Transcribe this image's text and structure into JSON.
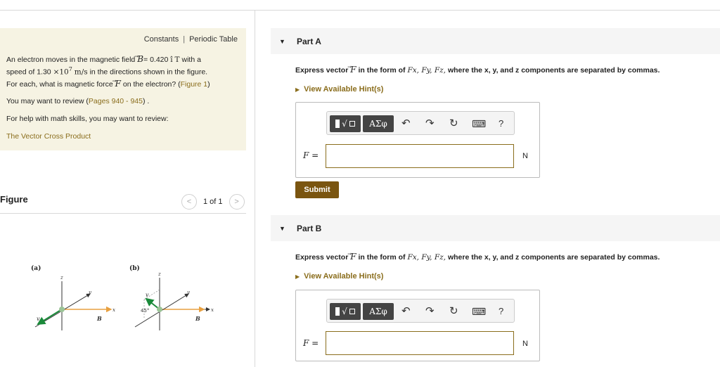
{
  "problem": {
    "links": {
      "constants": "Constants",
      "separator": "|",
      "periodic_table": "Periodic Table"
    },
    "line1_pre": "An electron moves in the magnetic field",
    "line1_B": "B",
    "line1_eq": "= 0.420",
    "line1_unit_vec": "î",
    "line1_unit": "T",
    "line1_post": "with a",
    "line2_pre": "speed of 1.30",
    "line2_times": "×10",
    "line2_exp": "7",
    "line2_unit": "m/s",
    "line2_post": "in the directions shown in the figure.",
    "line3_pre": "For each, what is magnetic force",
    "line3_F": "F",
    "line3_mid": "on the electron? (",
    "line3_link": "Figure 1",
    "line3_post": ")",
    "line4_pre": "You may want to review (",
    "line4_link": "Pages 940 - 945",
    "line4_post": ") .",
    "line5": "For help with math skills, you may want to review:",
    "line6_link": "The Vector Cross Product"
  },
  "figure": {
    "title": "Figure",
    "pager": "1 of 1",
    "prev": "<",
    "next": ">",
    "label_a": "(a)",
    "label_b": "(b)",
    "axis_x": "x",
    "axis_y": "y",
    "axis_z": "z",
    "vec_v": "v",
    "vec_B": "B",
    "angle": "45°"
  },
  "parts": [
    {
      "title": "Part A",
      "express_pre": "Express vector",
      "express_F": "F",
      "express_mid": "in the form of",
      "express_comps": "Fx, Fy, Fz,",
      "express_post": "where the x, y, and z components are separated by commas.",
      "hint": "View Available Hint(s)",
      "toolbar": {
        "greek": "ΑΣφ",
        "undo": "↶",
        "redo": "↷",
        "reset": "↻",
        "keyboard": "⌨",
        "help": "?"
      },
      "eq_label": "F =",
      "input_value": "",
      "unit": "N",
      "submit": "Submit"
    },
    {
      "title": "Part B",
      "express_pre": "Express vector",
      "express_F": "F",
      "express_mid": "in the form of",
      "express_comps": "Fx, Fy, Fz,",
      "express_post": "where the x, y, and z components are separated by commas.",
      "hint": "View Available Hint(s)",
      "toolbar": {
        "greek": "ΑΣφ",
        "undo": "↶",
        "redo": "↷",
        "reset": "↻",
        "keyboard": "⌨",
        "help": "?"
      },
      "eq_label": "F =",
      "input_value": "",
      "unit": "N"
    }
  ],
  "colors": {
    "accent": "#8a6d1c",
    "submit_bg": "#7a5510",
    "problem_bg": "#f6f3e3",
    "vector_v": "#1a8a3a",
    "vector_B": "#e8a040"
  }
}
